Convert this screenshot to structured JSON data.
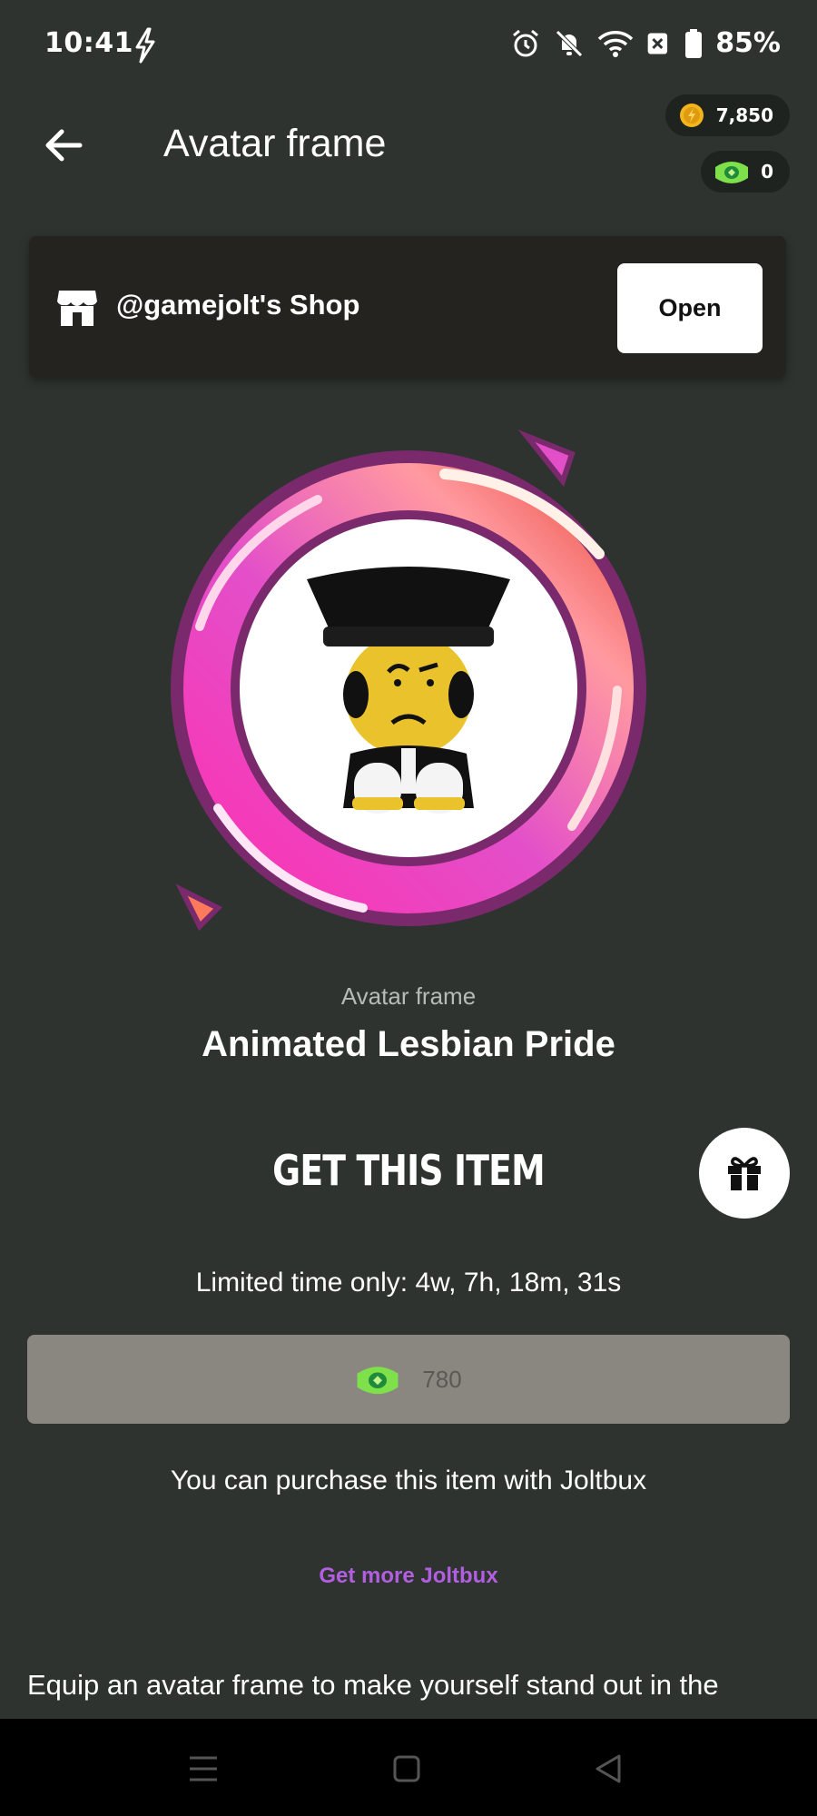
{
  "status_bar": {
    "time": "10:41",
    "battery_percent": "85%",
    "icons": [
      "bolt-icon",
      "alarm-icon",
      "bell-off-icon",
      "wifi-icon",
      "close-box-icon",
      "battery-icon"
    ]
  },
  "header": {
    "title": "Avatar frame",
    "coins": "7,850",
    "joltbux": "0"
  },
  "shop": {
    "name": "@gamejolt's Shop",
    "open_label": "Open"
  },
  "item": {
    "type_label": "Avatar frame",
    "name": "Animated Lesbian Pride"
  },
  "purchase": {
    "heading": "GET THIS ITEM",
    "limited_time": "Limited time only: 4w, 7h, 18m, 31s",
    "price": "780",
    "info": "You can purchase this item with Joltbux",
    "get_more_label": "Get more Joltbux"
  },
  "description": "Equip an avatar frame to make yourself stand out in the community.",
  "colors": {
    "background": "#2e332f",
    "accent_purple": "#b15fe0",
    "buy_button": "#8a8780",
    "frame_pink": "#e040c8",
    "frame_orange": "#ff7a5c"
  }
}
